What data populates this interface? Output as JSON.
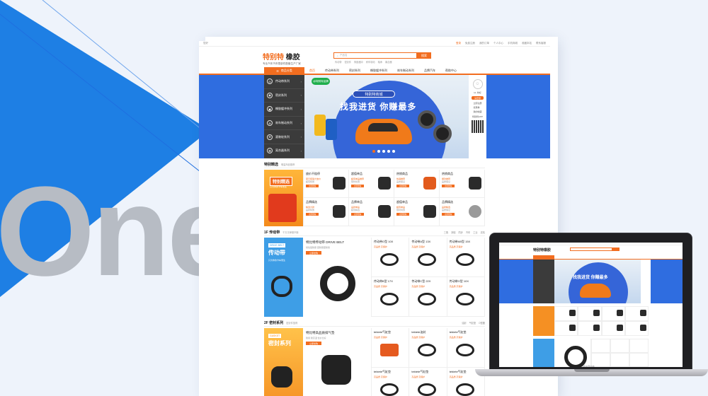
{
  "backdrop": {
    "watermark": "One"
  },
  "site": {
    "topbar": {
      "left": "您好",
      "links": [
        "登录",
        "免费注册",
        "我的订单",
        "个人中心",
        "手机商城",
        "收藏本站",
        "联系客服"
      ]
    },
    "logo": {
      "main_a": "特别特",
      "main_b": "橡胶",
      "tagline": "专业汽车汽车零部件配套生产厂家"
    },
    "search": {
      "placeholder": "产品名",
      "button": "搜索"
    },
    "hotwords": [
      "传动带",
      "密封件",
      "橡胶缓冲",
      "刹车制动",
      "轴承",
      "离合器"
    ],
    "nav": {
      "category": "商品分类",
      "items": [
        "首页",
        "传动带系列",
        "密封系列",
        "橡胶缓冲系列",
        "刹车制动系列",
        "品牌汽车",
        "帮助中心"
      ]
    },
    "sidebar": [
      {
        "label": "传动带系列"
      },
      {
        "label": "密封系列"
      },
      {
        "label": "橡胶缓冲系列"
      },
      {
        "label": "刹车制动系列"
      },
      {
        "label": "滚装轮系列"
      },
      {
        "label": "离合器系列"
      }
    ],
    "banner": {
      "badge": "@特别特品牌",
      "tag": "特别特商城",
      "slogan": "找我进货  你赚最多"
    },
    "user": {
      "greeting": "Hi, 你好",
      "login": "请登录",
      "links": [
        "立即注册",
        "优惠券",
        "我的收藏"
      ],
      "qr_label": "特别特APP"
    },
    "jingxuan": {
      "title": "特别精选",
      "subtitle": "明星商品推荐",
      "hero_title": "特别精选",
      "hero_sub": "只为你的卡车而生",
      "cells": [
        {
          "name": "放价不赔停",
          "d": "夏日促销大放价",
          "d2": "超值特惠",
          "btn": "立即抢购"
        },
        {
          "name": "超值单品",
          "d": "超值单品推荐",
          "d2": "限时优惠",
          "btn": "立即抢购"
        },
        {
          "name": "热销商品",
          "d": "热销推荐",
          "d2": "品质保证",
          "btn": "立即抢购"
        },
        {
          "name": "热销商品",
          "d": "爆款推荐",
          "d2": "品质保证",
          "btn": "立即抢购"
        },
        {
          "name": "品牌精选",
          "d": "精选大牌",
          "d2": "品牌特惠",
          "btn": "立即抢购"
        },
        {
          "name": "品牌单品",
          "d": "品牌单品",
          "d2": "超值精选",
          "btn": "立即抢购"
        },
        {
          "name": "超值单品",
          "d": "超值单品",
          "d2": "限时特惠",
          "btn": "立即抢购"
        },
        {
          "name": "品牌精选",
          "d": "品牌精选",
          "d2": "品质保证",
          "btn": "立即抢购"
        }
      ]
    },
    "floor1": {
      "title": "1F  传动带",
      "subtitle": "千万次摩擦不断",
      "links": [
        "三角",
        "多楔",
        "同步",
        "汽车",
        "工业",
        "农机"
      ],
      "hero_en": "DRIVE BELT",
      "hero_cn": "传动带",
      "hero_desc": "只为你的卡车而生",
      "feature_title": "特比特传动带 DRIVE BELT",
      "feature_sub": "韧性强耐磨 更耐磨更耐用",
      "feature_btn": "立即抢购",
      "cells": [
        {
          "name": "传动带O型 10X",
          "price": "高品质 高保护"
        },
        {
          "name": "传动带A型 13X",
          "price": "高品质 高保护"
        },
        {
          "name": "传动带AB型 15X",
          "price": "高品质 高保护"
        },
        {
          "name": "传动带B型 17X",
          "price": "高品质 高保护"
        },
        {
          "name": "传动带C型 22X",
          "price": "高品质 高保护"
        },
        {
          "name": "传动带O型 10X",
          "price": "高品质 高保护"
        }
      ]
    },
    "floor2": {
      "title": "2F  密封系列",
      "subtitle": "密封件值得",
      "links": [
        "油封",
        "气缸垫",
        "O型圈"
      ],
      "hero_en": "GASKET",
      "hero_cn": "密封系列",
      "feature_title": "特比特高品质排气垫",
      "feature_sub": "耐用 耐高温 性价比好",
      "feature_btn": "立即抢购",
      "cells": [
        {
          "name": "tebiete气缸垫",
          "price": "高品质 高保护"
        },
        {
          "name": "tebiete油封",
          "price": "高品质 高保护"
        },
        {
          "name": "tebiete气缸垫",
          "price": "高品质 高保护"
        },
        {
          "name": "tebiete气缸垫",
          "price": "高品质 高保护"
        },
        {
          "name": "tebiete气缸垫",
          "price": "高品质 高保护"
        },
        {
          "name": "tebiete气缸垫",
          "price": "高品质 高保护"
        }
      ]
    }
  },
  "laptop": {
    "brand": "MacBook",
    "logo": "特别特橡胶"
  },
  "colors": {
    "orange": "#f26d1f",
    "blue": "#2f6de0",
    "dark": "#3b3b3b",
    "light_blue": "#3e9ee6"
  }
}
